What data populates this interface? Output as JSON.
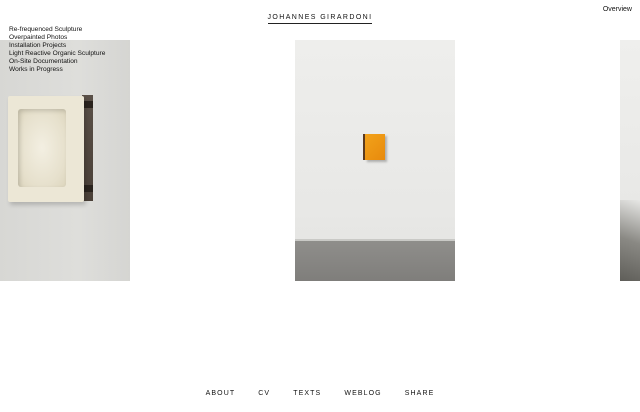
{
  "header": {
    "site_title": "JOHANNES GIRARDONI",
    "overview_link": "Overview"
  },
  "categories": [
    "Re-frequenced Sculpture",
    "Overpainted Photos",
    "Installation Projects",
    "Light Reactive Organic Sculpture",
    "On-Site Documentation",
    "Works in Progress"
  ],
  "footer": {
    "links": [
      "ABOUT",
      "CV",
      "TEXTS",
      "WEBLOG",
      "SHARE"
    ]
  },
  "colors": {
    "background": "#ffffff",
    "text": "#111111",
    "accent_orange": "#f2a21a"
  }
}
